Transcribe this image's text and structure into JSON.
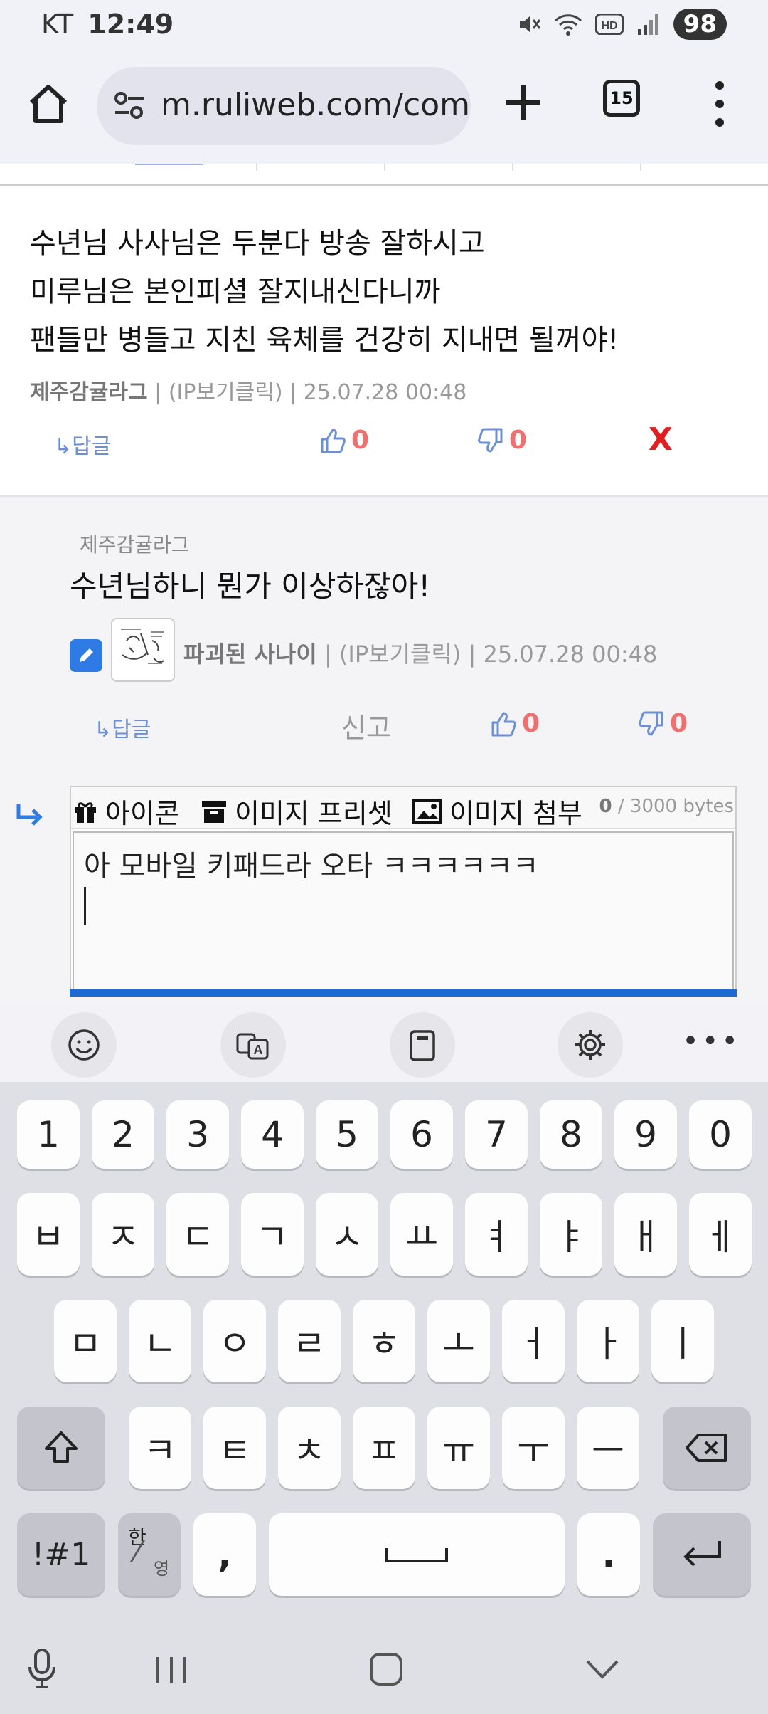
{
  "status_bar": {
    "carrier": "KT",
    "time": "12:49",
    "battery": "98"
  },
  "browser": {
    "url": "m.ruliweb.com/comn",
    "tab_count": "15"
  },
  "comment1": {
    "lines": [
      "수년님 사사님은 두분다 방송 잘하시고",
      "미루님은 본인피셜 잘지내신다니까",
      "팬들만 병들고 지친 육체를 건강히 지내면 될꺼야!"
    ],
    "author": "제주감귤라그",
    "ip": "(IP보기클릭)",
    "date": "25.07.28 00:48",
    "reply_label": "↳답글",
    "likes": "0",
    "dislikes": "0",
    "delete_label": "X"
  },
  "comment2": {
    "reply_to": "제주감귤라그",
    "text": "수년님하니 뭔가 이상하잖아!",
    "author": "파괴된 사나이",
    "ip": "(IP보기클릭)",
    "date": "25.07.28 00:48",
    "reply_label": "↳답글",
    "report_label": "신고",
    "likes": "0",
    "dislikes": "0"
  },
  "composer": {
    "icon_label": "아이콘",
    "preset_label": "이미지 프리셋",
    "attach_label": "이미지 첨부",
    "bytes_count": "0",
    "bytes_max": "/ 3000 bytes",
    "text_value": "아 모바일 키패드라 오타 ㅋㅋㅋㅋㅋㅋ"
  },
  "keyboard": {
    "row_numbers": [
      "1",
      "2",
      "3",
      "4",
      "5",
      "6",
      "7",
      "8",
      "9",
      "0"
    ],
    "row1": [
      "ㅂ",
      "ㅈ",
      "ㄷ",
      "ㄱ",
      "ㅅ",
      "ㅛ",
      "ㅕ",
      "ㅑ",
      "ㅐ",
      "ㅔ"
    ],
    "row2": [
      "ㅁ",
      "ㄴ",
      "ㅇ",
      "ㄹ",
      "ㅎ",
      "ㅗ",
      "ㅓ",
      "ㅏ",
      "ㅣ"
    ],
    "row3": [
      "ㅋ",
      "ㅌ",
      "ㅊ",
      "ㅍ",
      "ㅠ",
      "ㅜ",
      "ㅡ"
    ],
    "symbols_label": "!#1",
    "lang_top": "한",
    "lang_bottom": "영",
    "comma": ",",
    "period": "."
  }
}
